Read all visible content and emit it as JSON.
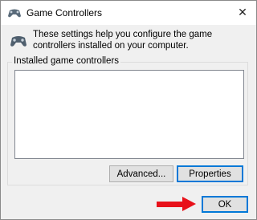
{
  "window": {
    "title": "Game Controllers",
    "close_glyph": "✕"
  },
  "info": {
    "text": "These settings help you configure the game controllers installed on your computer.",
    "icon": "gamepad-icon"
  },
  "group": {
    "label": "Installed game controllers",
    "items": []
  },
  "buttons": {
    "advanced": "Advanced...",
    "properties": "Properties",
    "ok": "OK"
  },
  "annotation": {
    "arrow_color": "#e8111a"
  }
}
